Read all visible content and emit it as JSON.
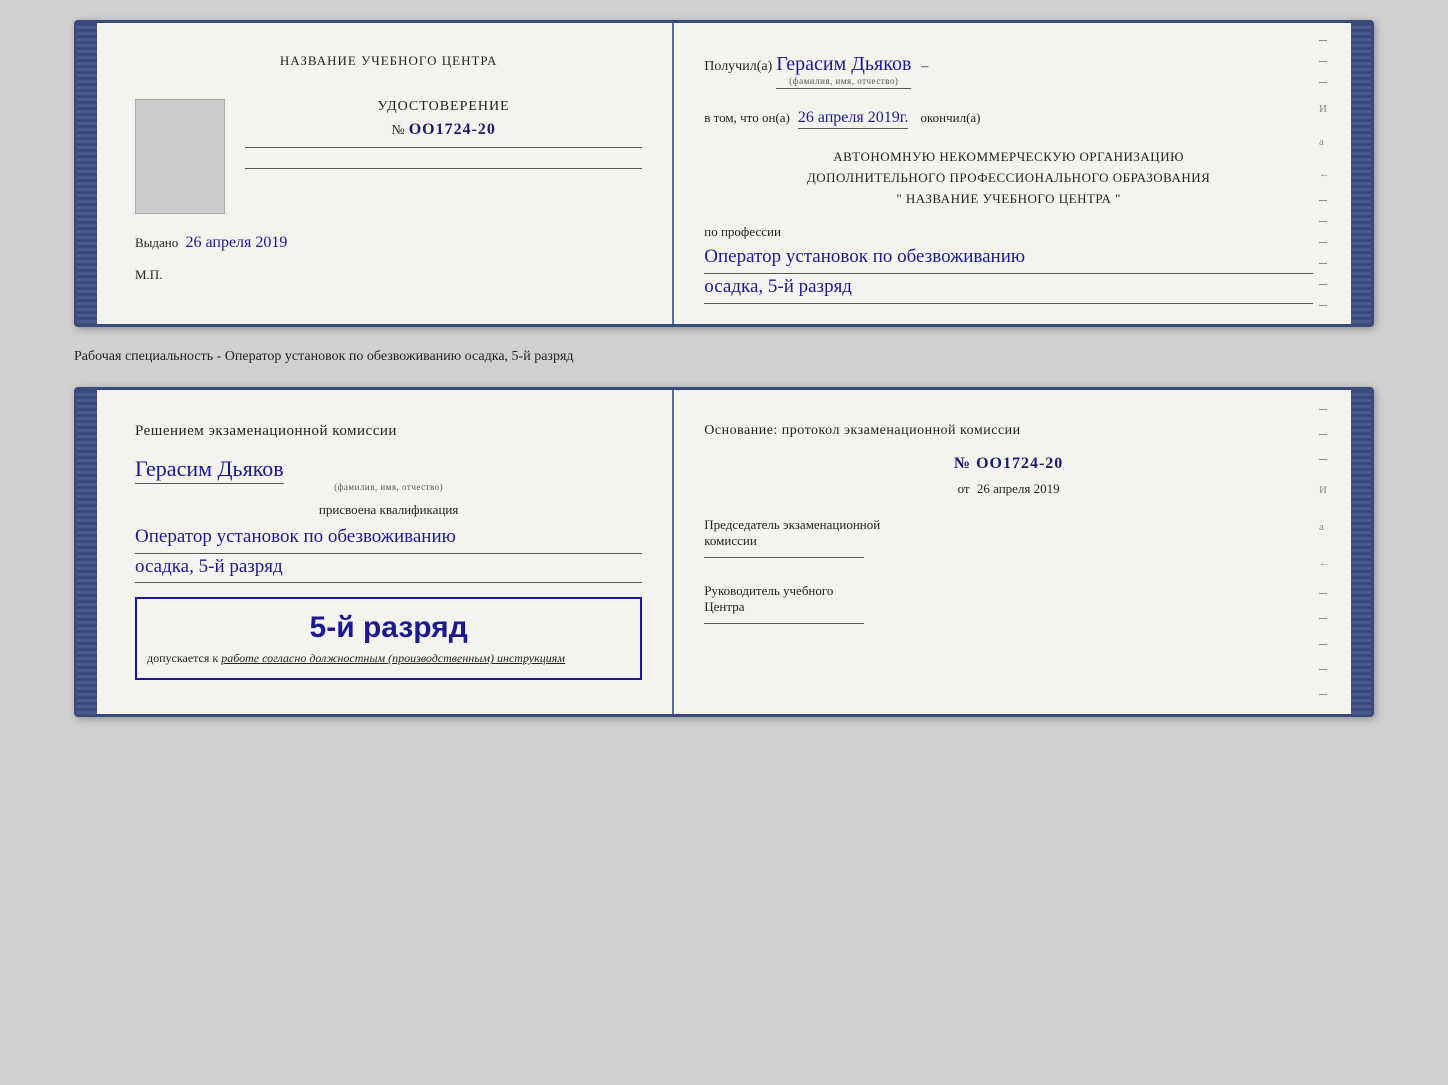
{
  "topCard": {
    "leftPanel": {
      "title": "НАЗВАНИЕ УЧЕБНОГО ЦЕНТРА",
      "udostoverenie": "УДОСТОВЕРЕНИЕ",
      "number_prefix": "№",
      "number": "OO1724-20",
      "vydano_label": "Выдано",
      "vydano_date": "26 апреля 2019",
      "mp": "М.П."
    },
    "rightPanel": {
      "poluchil": "Получил(а)",
      "recipient_name": "Герасим Дьяков",
      "recipient_label": "(фамилия, имя, отчество)",
      "dash": "–",
      "vtom": "в том, что он(а)",
      "date": "26 апреля 2019г.",
      "okonchil": "окончил(а)",
      "org_line1": "АВТОНОМНУЮ НЕКОММЕРЧЕСКУЮ ОРГАНИЗАЦИЮ",
      "org_line2": "ДОПОЛНИТЕЛЬНОГО ПРОФЕССИОНАЛЬНОГО ОБРАЗОВАНИЯ",
      "org_line3": "\"   НАЗВАНИЕ УЧЕБНОГО ЦЕНТРА   \"",
      "po_professii": "по профессии",
      "professiya_line1": "Оператор установок по обезвоживанию",
      "professiya_line2": "осадка, 5-й разряд"
    }
  },
  "specLabel": "Рабочая специальность - Оператор установок по обезвоживанию осадка, 5-й разряд",
  "bottomCard": {
    "leftPanel": {
      "resheniem": "Решением экзаменационной комиссии",
      "recipient_name": "Герасим Дьяков",
      "recipient_label": "(фамилия, имя, отчество)",
      "prisvoena": "присвоена квалификация",
      "qualification_line1": "Оператор установок по обезвоживанию",
      "qualification_line2": "осадка, 5-й разряд",
      "stamp_rank": "5-й разряд",
      "dopuskaetsya": "допускается к",
      "dopusk_text": "работе согласно должностным (производственным) инструкциям"
    },
    "rightPanel": {
      "osnovanie": "Основание: протокол экзаменационной комиссии",
      "number_prefix": "№",
      "number": "OO1724-20",
      "ot_prefix": "от",
      "ot_date": "26 апреля 2019",
      "predsedatel_line1": "Председатель экзаменационной",
      "predsedatel_line2": "комиссии",
      "rukovoditel_line1": "Руководитель учебного",
      "rukovoditel_line2": "Центра"
    }
  },
  "marginLetters": [
    "И",
    "а",
    "←",
    "–",
    "–",
    "–",
    "–"
  ]
}
